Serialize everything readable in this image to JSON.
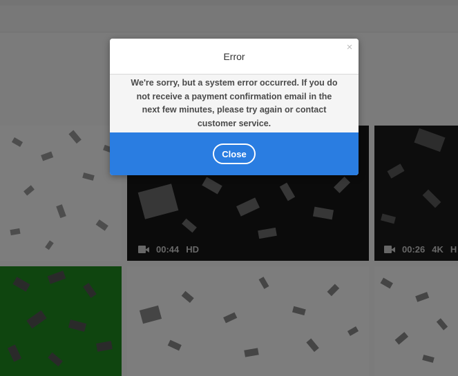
{
  "colors": {
    "accent": "#2a7de1",
    "overlay": "rgba(0,0,0,0.5)",
    "green_screen": "#1f8a1f",
    "dark_tile": "#141414"
  },
  "modal": {
    "title": "Error",
    "message": "We're sorry, but a system error occurred. If you do not receive a payment confirmation email in the next few minutes, please try again or contact customer service.",
    "close_icon": "×",
    "close_button_label": "Close"
  },
  "results": [
    {
      "duration": "",
      "quality": "",
      "theme": "light"
    },
    {
      "duration": "00:44",
      "quality": "HD",
      "theme": "dark",
      "icon": "video-camera-icon"
    },
    {
      "duration": "00:26",
      "quality": "4K",
      "quality_extra": "H",
      "theme": "dark",
      "icon": "video-camera-icon"
    },
    {
      "duration": "",
      "quality": "",
      "theme": "green"
    },
    {
      "duration": "",
      "quality": "",
      "theme": "light"
    },
    {
      "duration": "",
      "quality": "",
      "theme": "light"
    }
  ]
}
